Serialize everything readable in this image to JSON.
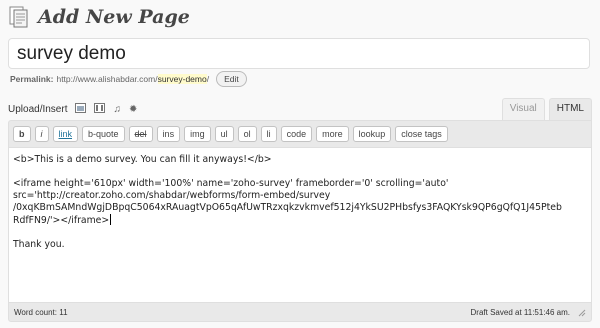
{
  "header": {
    "title": "Add New Page",
    "icon": "pages-icon"
  },
  "title_field": {
    "value": "survey demo"
  },
  "permalink": {
    "label": "Permalink:",
    "base_url": "http://www.alishabdar.com/",
    "slug": "survey-demo",
    "trailing": "/",
    "edit_label": "Edit"
  },
  "media": {
    "label": "Upload/Insert",
    "icons": [
      "add-image-icon",
      "add-video-icon",
      "add-audio-icon",
      "add-media-icon"
    ]
  },
  "editor_tabs": [
    {
      "label": "Visual",
      "active": false
    },
    {
      "label": "HTML",
      "active": true
    }
  ],
  "quicktags": [
    "b",
    "i",
    "link",
    "b-quote",
    "del",
    "ins",
    "img",
    "ul",
    "ol",
    "li",
    "code",
    "more",
    "lookup",
    "close tags"
  ],
  "content": {
    "lines": [
      "<b>This is a demo survey. You can fill it anyways!</b>",
      "",
      "<iframe height='610px' width='100%' name='zoho-survey' frameborder='0' scrolling='auto'",
      "src='http://creator.zoho.com/shabdar/webforms/form-embed/survey",
      "/0xqKBmSAMndWgjDBpqC5064xRAuagtVpO65qAfUwTRzxqkzvkmvef512j4YkSU2PHbsfys3FAQKYsk9QP6gQfQ1J45Pteb",
      "RdfFN9/'></iframe>",
      "",
      "Thank you."
    ]
  },
  "status": {
    "word_count": "Word count: 11",
    "draft_saved": "Draft Saved at 11:51:46 am."
  },
  "colors": {
    "link": "#21759b",
    "slug_highlight": "#fffbcc",
    "editor_chrome": "#e9e9e9"
  }
}
